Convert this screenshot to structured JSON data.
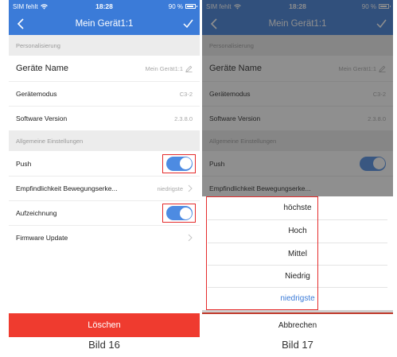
{
  "status": {
    "carrier": "SIM fehlt",
    "time": "18:28",
    "battery": "90 %"
  },
  "nav": {
    "title": "Mein Gerät1:1"
  },
  "sections": {
    "personal": "Personalisierung",
    "general": "Allgemeine Einstellungen"
  },
  "rows": {
    "device_name": {
      "label": "Geräte Name",
      "value": "Mein Gerät1:1"
    },
    "device_mode": {
      "label": "Gerätemodus",
      "value": "C3-2"
    },
    "software": {
      "label": "Software Version",
      "value": "2.3.8.0"
    },
    "push": {
      "label": "Push",
      "on": true
    },
    "sensitivity": {
      "label": "Empfindlichkeit Bewegungserke...",
      "value": "niedrigste"
    },
    "recording": {
      "label": "Aufzeichnung",
      "on": true
    },
    "firmware": {
      "label": "Firmware Update"
    }
  },
  "delete_label": "Löschen",
  "picker": {
    "options": [
      "höchste",
      "Hoch",
      "Mittel",
      "Niedrig",
      "niedrigste"
    ],
    "selected": "niedrigste",
    "cancel": "Abbrechen"
  },
  "captions": {
    "left": "Bild 16",
    "right": "Bild 17"
  },
  "colors": {
    "accent": "#3b7bd8",
    "delete": "#ef3b2f",
    "highlight": "#e52b2b",
    "toggle": "#4d8be2"
  },
  "icons": [
    "wifi-icon",
    "battery-icon",
    "back-chevron-icon",
    "checkmark-icon",
    "pencil-icon",
    "chevron-right-icon"
  ]
}
